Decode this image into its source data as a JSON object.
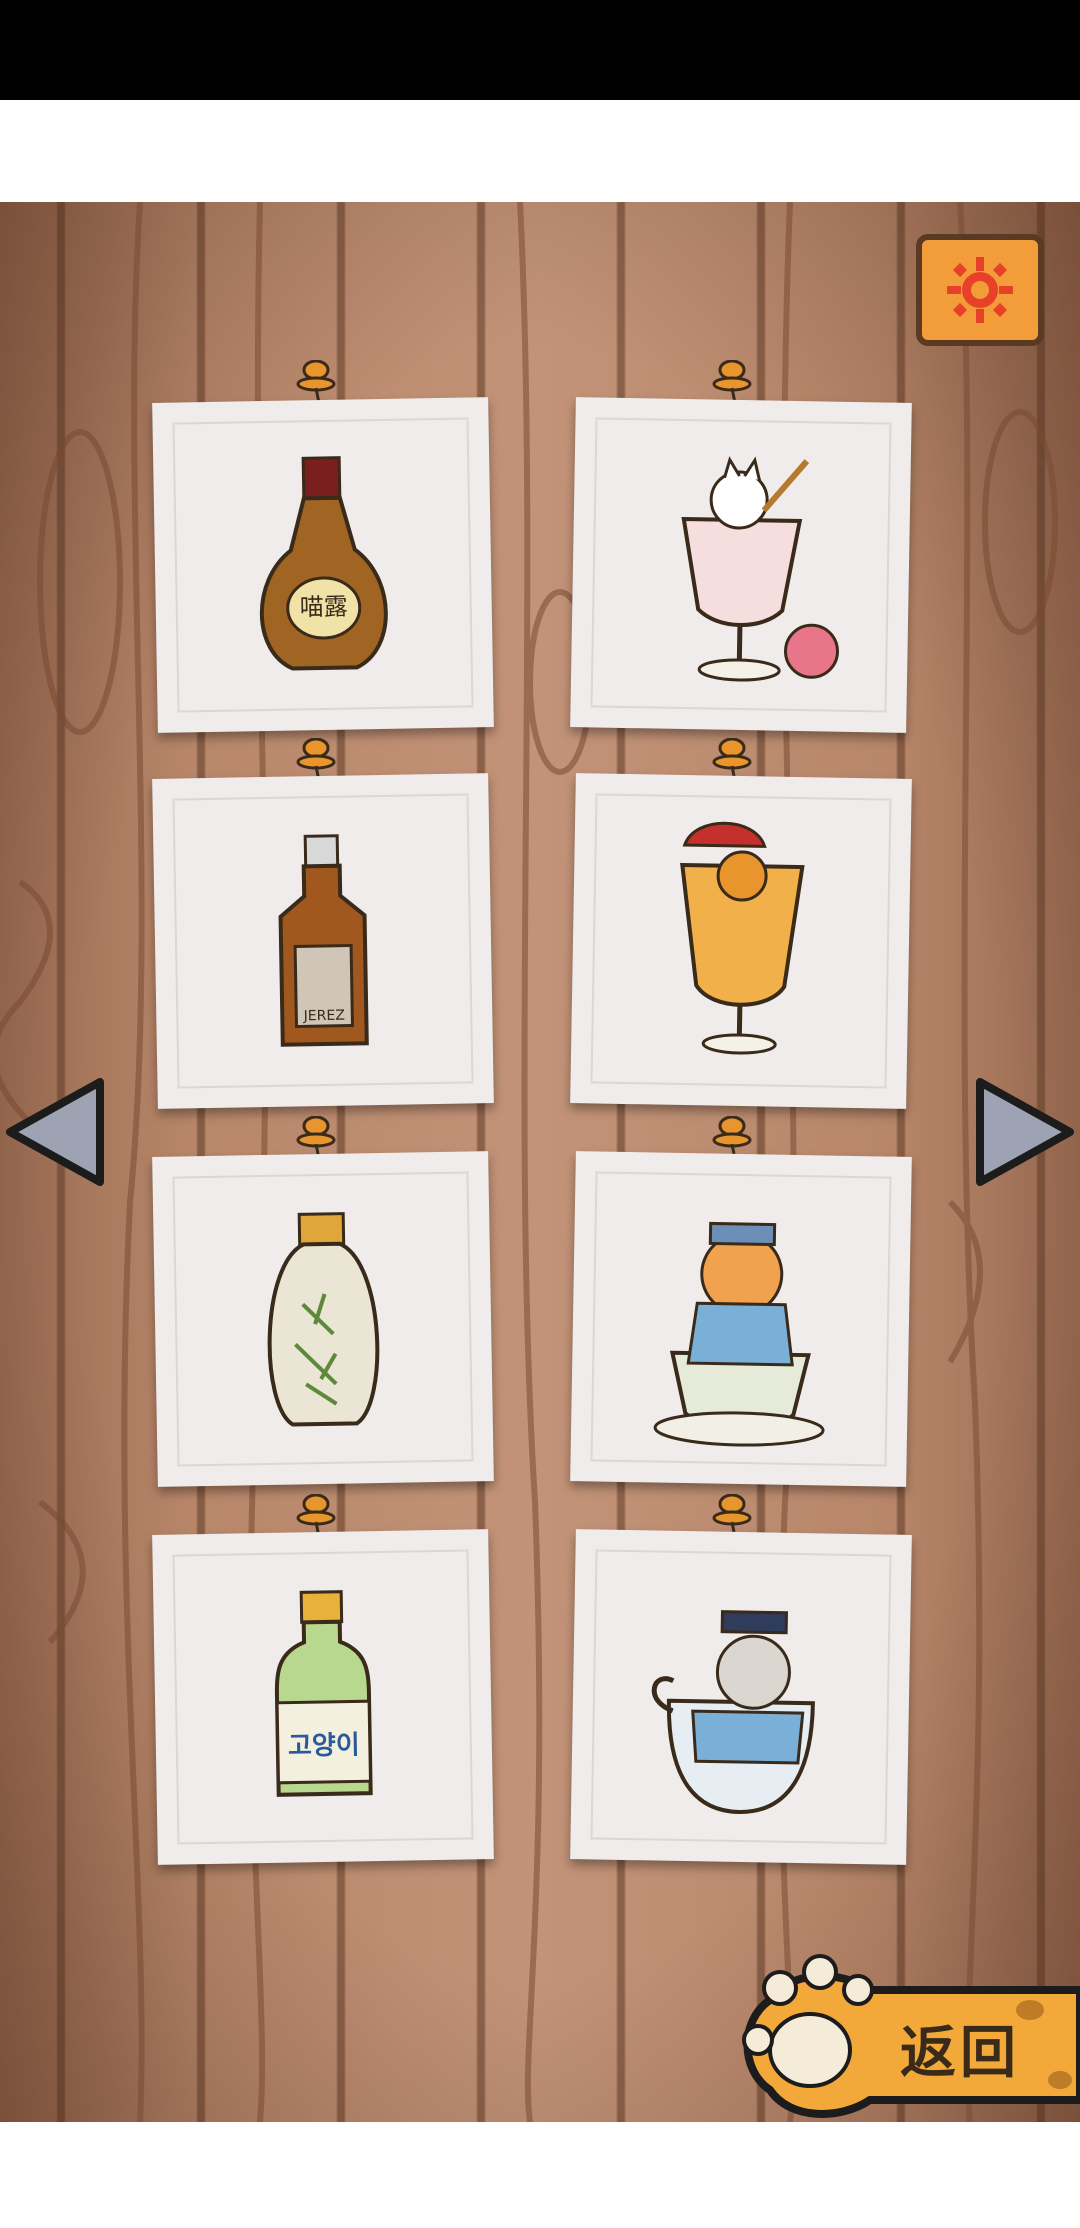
{
  "cards": [
    {
      "name": "ceramic-bottle-sign-label",
      "label": "喵露"
    },
    {
      "name": "cat-in-wine-glass",
      "label": ""
    },
    {
      "name": "whisky-bottle-cat",
      "label": "JEREZ"
    },
    {
      "name": "cat-in-cocktail-glass",
      "label": ""
    },
    {
      "name": "bamboo-vase-bottle",
      "label": ""
    },
    {
      "name": "cat-in-teacup",
      "label": ""
    },
    {
      "name": "soju-bottle",
      "label": "고양이"
    },
    {
      "name": "cat-in-glass-bowl",
      "label": ""
    }
  ],
  "buttons": {
    "back_label": "返回"
  },
  "colors": {
    "wood": "#c29378",
    "card": "#efeceb",
    "gear_button": "#f29c3a",
    "paw": "#f2a93a"
  },
  "icons": {
    "settings": "gear-icon",
    "prev": "left-arrow-icon",
    "next": "right-arrow-icon",
    "back": "paw-icon"
  }
}
